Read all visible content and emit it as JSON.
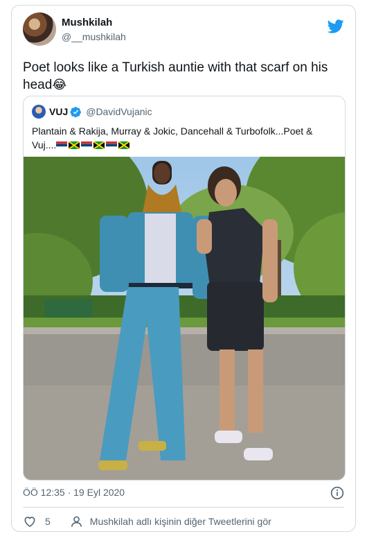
{
  "author": {
    "display_name": "Mushkilah",
    "handle": "@__mushkilah"
  },
  "tweet": {
    "text": "Poet looks like a Turkish auntie with that scarf on his head",
    "emoji": "😂"
  },
  "quoted": {
    "display_name": "VUJ",
    "handle": "@DavidVujanic",
    "text": "Plantain & Rakija, Murray & Jokic, Dancehall & Turbofolk...Poet & Vuj....",
    "flags": [
      "serbia",
      "jamaica",
      "serbia",
      "jamaica",
      "serbia",
      "jamaica"
    ]
  },
  "meta": {
    "timestamp": "ÖÖ 12:35 · 19 Eyl 2020"
  },
  "footer": {
    "like_count": "5",
    "more_tweets_label": "Mushkilah adlı kişinin diğer Tweetlerini gör"
  },
  "icons": {
    "brand": "twitter-bird-icon",
    "verified": "verified-badge-icon",
    "info": "info-icon",
    "like": "heart-icon",
    "profile": "person-icon"
  },
  "colors": {
    "brand": "#1d9bf0",
    "secondary_text": "#536471",
    "border": "#cfd9de"
  }
}
